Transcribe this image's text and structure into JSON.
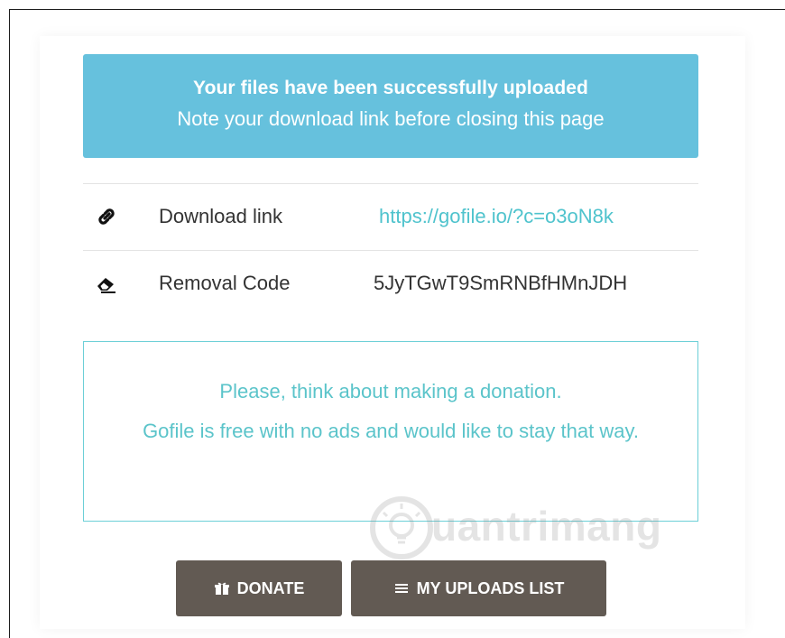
{
  "alert": {
    "title": "Your files have been successfully uploaded",
    "subtitle": "Note your download link before closing this page",
    "background": "#66c1dd"
  },
  "rows": [
    {
      "icon": "link-icon",
      "label": "Download link",
      "value": "https://gofile.io/?c=o3oN8k"
    },
    {
      "icon": "eraser-icon",
      "label": "Removal Code",
      "value": "5JyTGwT9SmRNBfHMnJDH"
    }
  ],
  "donation": {
    "line1": "Please, think about making a donation.",
    "line2": "Gofile is free with no ads and would like to stay that way.",
    "color": "#5bc4ca"
  },
  "watermark": {
    "text": "uantrimang"
  },
  "buttons": {
    "donate": {
      "label": "DONATE",
      "icon": "gift-icon"
    },
    "uploads": {
      "label": "MY UPLOADS LIST",
      "icon": "list-icon"
    },
    "background": "#625a53"
  }
}
